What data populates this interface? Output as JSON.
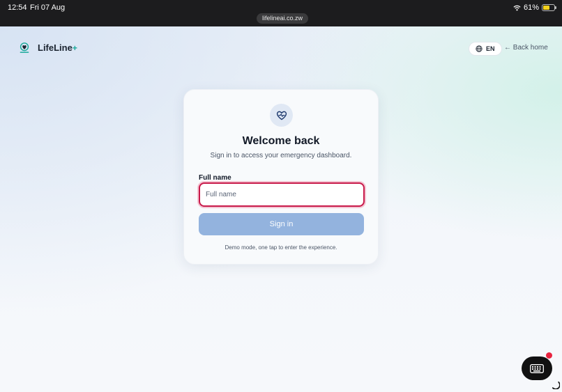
{
  "status_bar": {
    "time": "12:54",
    "date": "Fri 07 Aug",
    "url": "lifelineai.co.zw",
    "battery_percent_label": "61%",
    "battery_level": 0.61
  },
  "header": {
    "brand_name": "LifeLine",
    "brand_plus": "+",
    "language_label": "EN",
    "back_link_label": "← Back home"
  },
  "login_card": {
    "title": "Welcome back",
    "subtitle": "Sign in to access your emergency dashboard.",
    "field_label": "Full name",
    "field_placeholder": "Full name",
    "field_value": "",
    "submit_label": "Sign in",
    "demo_note": "Demo mode, one tap to enter the experience."
  },
  "icons": {
    "brand": "lifeline-logo-icon",
    "card": "heart-pulse-icon",
    "language": "globe-icon",
    "fab": "keyboard-icon",
    "wifi": "wifi-icon",
    "battery": "battery-icon"
  },
  "colors": {
    "accent": "#1aa99a",
    "button": "#93b3de",
    "focus_ring": "#c8194a",
    "badge": "#e8233f"
  }
}
